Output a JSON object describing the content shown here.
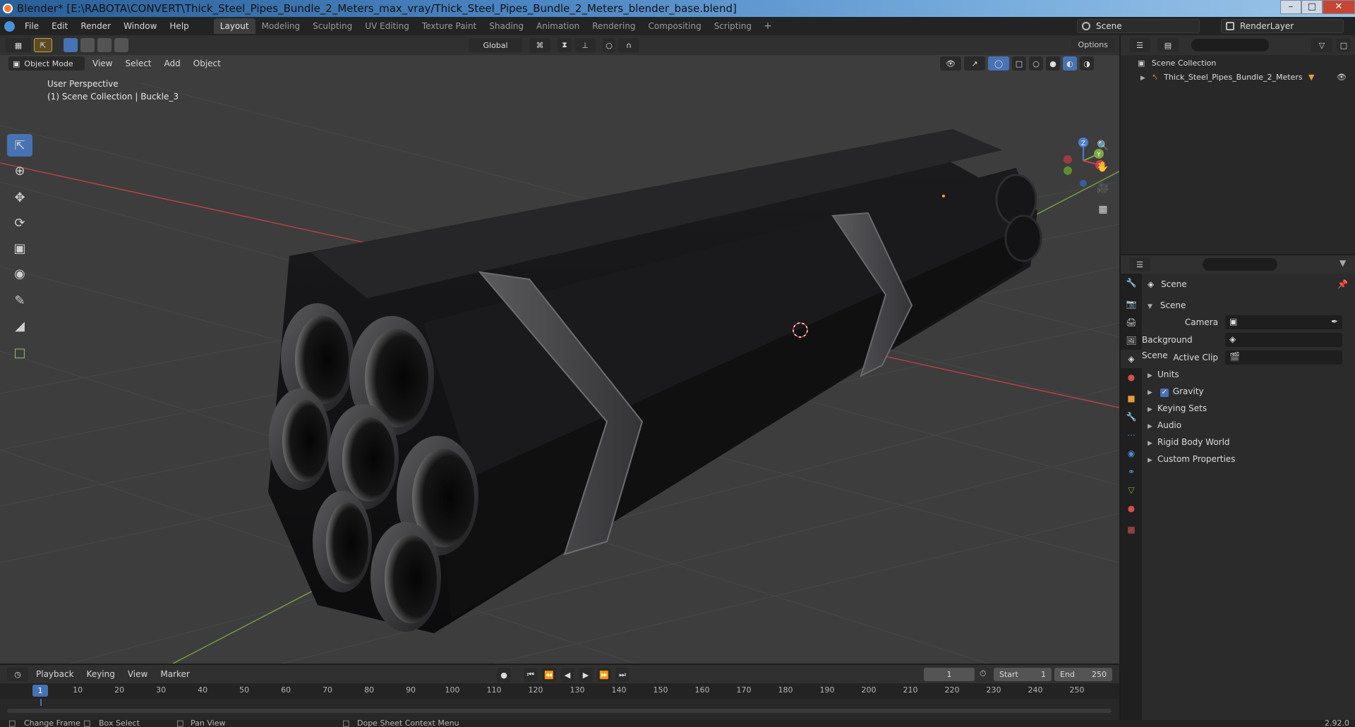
{
  "window": {
    "title": "Blender* [E:\\RABOTA\\CONVERT\\Thick_Steel_Pipes_Bundle_2_Meters_max_vray/Thick_Steel_Pipes_Bundle_2_Meters_blender_base.blend]",
    "minimize": "–",
    "maximize": "□",
    "close": "✕"
  },
  "topbar": {
    "menus": [
      "File",
      "Edit",
      "Render",
      "Window",
      "Help"
    ],
    "workspaces": [
      "Layout",
      "Modeling",
      "Sculpting",
      "UV Editing",
      "Texture Paint",
      "Shading",
      "Animation",
      "Rendering",
      "Compositing",
      "Scripting"
    ],
    "active_workspace": "Layout",
    "add_workspace": "+",
    "scene": "Scene",
    "view_layer": "RenderLayer"
  },
  "viewport_header": {
    "mode": "Object Mode",
    "menus": [
      "View",
      "Select",
      "Add",
      "Object"
    ],
    "orientation": "Global",
    "options": "Options"
  },
  "viewport": {
    "view_name": "User Perspective",
    "collection_info": "(1) Scene Collection | Buckle_3",
    "tools": [
      "select-box",
      "cursor",
      "move",
      "rotate",
      "scale",
      "transform",
      "annotate",
      "measure",
      "add-cube"
    ],
    "active_tool": "select-box",
    "gizmo": {
      "x": "X",
      "y": "Y",
      "z": "Z"
    }
  },
  "timeline": {
    "menus": [
      "Playback",
      "Keying",
      "View",
      "Marker"
    ],
    "current_frame": "1",
    "start_label": "Start",
    "start": "1",
    "end_label": "End",
    "end": "250",
    "ticks": [
      "1",
      "10",
      "20",
      "30",
      "40",
      "50",
      "60",
      "70",
      "80",
      "90",
      "100",
      "110",
      "120",
      "130",
      "140",
      "150",
      "160",
      "170",
      "180",
      "190",
      "200",
      "210",
      "220",
      "230",
      "240",
      "250"
    ]
  },
  "statusbar": {
    "change_frame": "Change Frame",
    "box_select": "Box Select",
    "pan_view": "Pan View",
    "context_menu": "Dope Sheet Context Menu",
    "version": "2.92.0"
  },
  "outliner": {
    "root": "Scene Collection",
    "items": [
      {
        "label": "Thick_Steel_Pipes_Bundle_2_Meters"
      }
    ]
  },
  "properties": {
    "context": "Scene",
    "panel": "Scene",
    "fields": [
      {
        "label": "Camera"
      },
      {
        "label": "Background Scene"
      },
      {
        "label": "Active Clip"
      }
    ],
    "sections": [
      "Units",
      "Gravity",
      "Keying Sets",
      "Audio",
      "Rigid Body World",
      "Custom Properties"
    ],
    "gravity_checked": true
  },
  "colors": {
    "accent": "#4772b3",
    "x_axis": "#c8414b",
    "y_axis": "#7fa842",
    "z_axis": "#4a7fd0",
    "viewport_bg": "#3d3d3d"
  }
}
